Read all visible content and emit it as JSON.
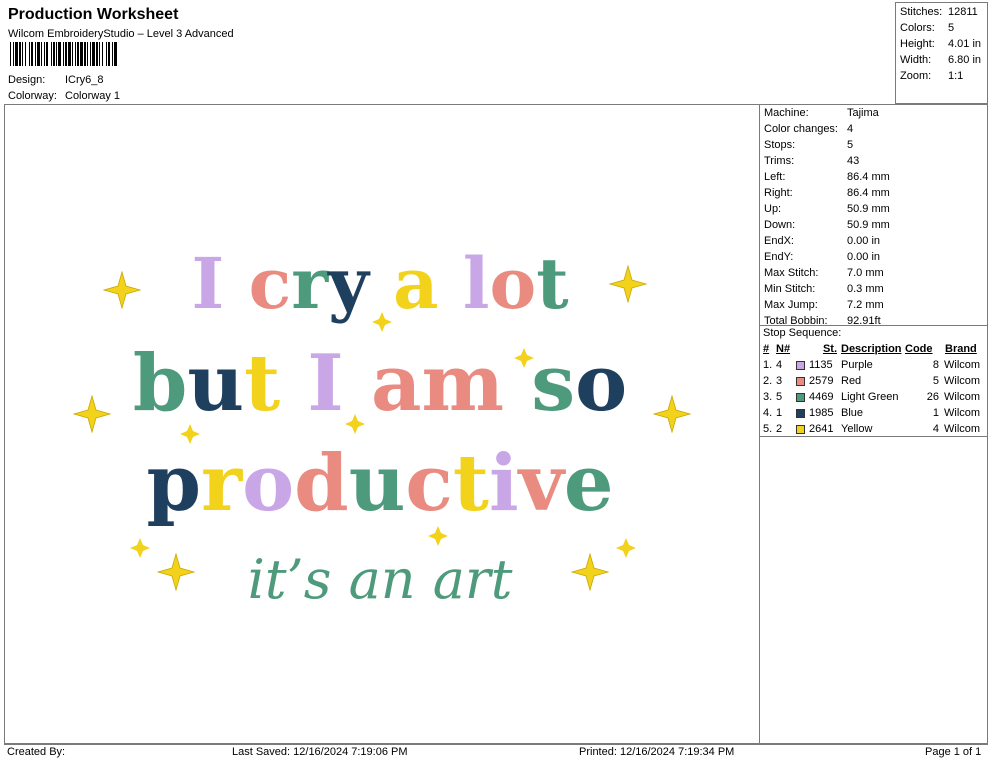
{
  "header": {
    "title": "Production Worksheet",
    "subtitle": "Wilcom EmbroideryStudio – Level 3 Advanced",
    "design_label": "Design:",
    "design_value": "ICry6_8",
    "colorway_label": "Colorway:",
    "colorway_value": "Colorway 1"
  },
  "top_stats": [
    {
      "label": "Stitches:",
      "value": "12811"
    },
    {
      "label": "Colors:",
      "value": "5"
    },
    {
      "label": "Height:",
      "value": "4.01 in"
    },
    {
      "label": "Width:",
      "value": "6.80 in"
    },
    {
      "label": "Zoom:",
      "value": "1:1"
    }
  ],
  "machine_info": [
    {
      "label": "Machine:",
      "value": "Tajima"
    },
    {
      "label": "Color changes:",
      "value": "4"
    },
    {
      "label": "Stops:",
      "value": "5"
    },
    {
      "label": "Trims:",
      "value": "43"
    },
    {
      "label": "Left:",
      "value": "86.4 mm"
    },
    {
      "label": "Right:",
      "value": "86.4 mm"
    },
    {
      "label": "Up:",
      "value": "50.9 mm"
    },
    {
      "label": "Down:",
      "value": "50.9 mm"
    },
    {
      "label": "EndX:",
      "value": "0.00 in"
    },
    {
      "label": "EndY:",
      "value": "0.00 in"
    },
    {
      "label": "Max Stitch:",
      "value": "7.0 mm"
    },
    {
      "label": "Min Stitch:",
      "value": "0.3 mm"
    },
    {
      "label": "Max Jump:",
      "value": "7.2 mm"
    },
    {
      "label": "Total Bobbin:",
      "value": "92.91ft"
    }
  ],
  "stop_sequence": {
    "heading": "Stop Sequence:",
    "columns": [
      "#",
      "N#",
      "St.",
      "Description",
      "Code",
      "Brand"
    ],
    "rows": [
      {
        "num": "1.",
        "n": "4",
        "st": "1135",
        "desc": "Purple",
        "code": "8",
        "brand": "Wilcom",
        "color": "#c9a6e6"
      },
      {
        "num": "2.",
        "n": "3",
        "st": "2579",
        "desc": "Red",
        "code": "5",
        "brand": "Wilcom",
        "color": "#e98b80"
      },
      {
        "num": "3.",
        "n": "5",
        "st": "4469",
        "desc": "Light Green",
        "code": "26",
        "brand": "Wilcom",
        "color": "#4e9a7c"
      },
      {
        "num": "4.",
        "n": "1",
        "st": "1985",
        "desc": "Blue",
        "code": "1",
        "brand": "Wilcom",
        "color": "#1f3f5e"
      },
      {
        "num": "5.",
        "n": "2",
        "st": "2641",
        "desc": "Yellow",
        "code": "4",
        "brand": "Wilcom",
        "color": "#f2d21b"
      }
    ]
  },
  "design_text": {
    "line1": "I cry a lot",
    "line2": "but I am so",
    "line3": "productive",
    "line4": "it’s an art"
  },
  "footer": {
    "created_by": "Created By:",
    "last_saved": "Last Saved: 12/16/2024 7:19:06 PM",
    "printed": "Printed: 12/16/2024 7:19:34 PM",
    "page": "Page 1 of 1"
  }
}
